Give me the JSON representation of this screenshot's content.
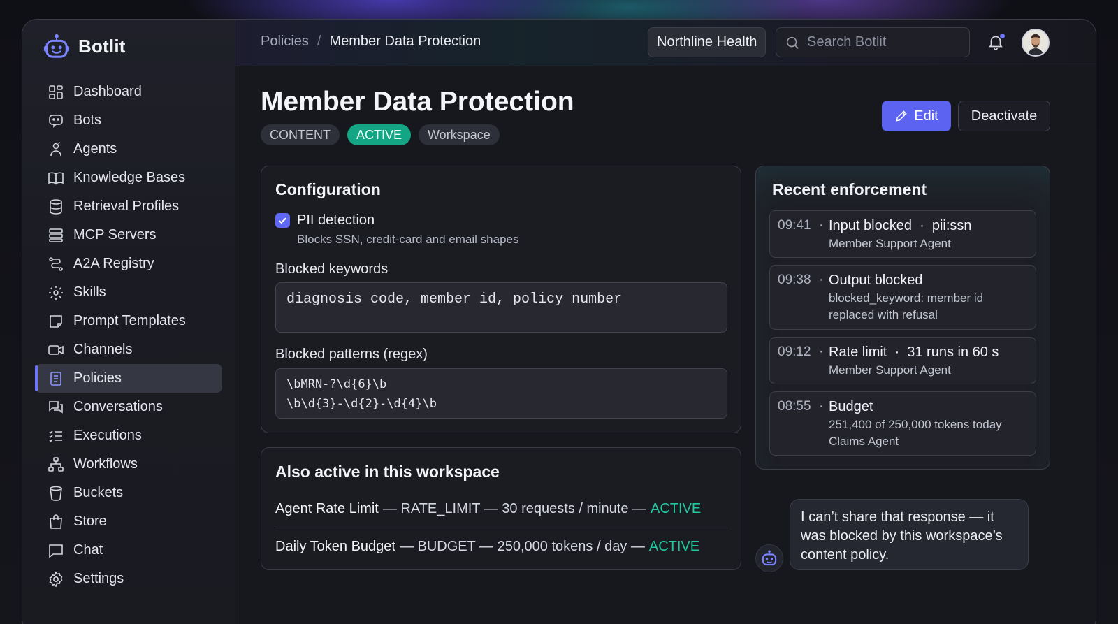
{
  "app": {
    "name": "Botlit"
  },
  "sidebar": {
    "items": [
      {
        "label": "Dashboard",
        "icon": "dashboard-icon"
      },
      {
        "label": "Bots",
        "icon": "bot-icon"
      },
      {
        "label": "Agents",
        "icon": "agent-icon"
      },
      {
        "label": "Knowledge Bases",
        "icon": "book-icon"
      },
      {
        "label": "Retrieval Profiles",
        "icon": "database-icon"
      },
      {
        "label": "MCP Servers",
        "icon": "server-icon"
      },
      {
        "label": "A2A Registry",
        "icon": "route-icon"
      },
      {
        "label": "Skills",
        "icon": "gear-icon"
      },
      {
        "label": "Prompt Templates",
        "icon": "sticky-note-icon"
      },
      {
        "label": "Channels",
        "icon": "video-icon"
      },
      {
        "label": "Policies",
        "icon": "document-icon",
        "active": true
      },
      {
        "label": "Conversations",
        "icon": "chat-bubbles-icon"
      },
      {
        "label": "Executions",
        "icon": "list-icon"
      },
      {
        "label": "Workflows",
        "icon": "workflow-icon"
      },
      {
        "label": "Buckets",
        "icon": "bucket-icon"
      },
      {
        "label": "Store",
        "icon": "shopping-bag-icon"
      },
      {
        "label": "Chat",
        "icon": "chat-icon"
      },
      {
        "label": "Settings",
        "icon": "settings-icon"
      }
    ]
  },
  "topbar": {
    "breadcrumb": {
      "parent": "Policies",
      "separator": "/",
      "current": "Member Data Protection"
    },
    "org": "Northline Health",
    "search_placeholder": "Search Botlit"
  },
  "page": {
    "title": "Member Data Protection",
    "tags": [
      {
        "label": "CONTENT",
        "style": "neutral"
      },
      {
        "label": "ACTIVE",
        "style": "active"
      },
      {
        "label": "Workspace",
        "style": "neutral"
      }
    ],
    "edit_label": "Edit",
    "deactivate_label": "Deactivate"
  },
  "configuration": {
    "title": "Configuration",
    "pii": {
      "label": "PII detection",
      "checked": true,
      "help": "Blocks SSN, credit-card and email shapes"
    },
    "keywords_label": "Blocked keywords",
    "keywords_value": "diagnosis code, member id, policy number",
    "patterns_label": "Blocked patterns (regex)",
    "patterns_value": "\\bMRN-?\\d{6}\\b\n\\b\\d{3}-\\d{2}-\\d{4}\\b"
  },
  "also_active": {
    "title": "Also active in this workspace",
    "rows": [
      {
        "name": "Agent Rate Limit",
        "details": "— RATE_LIMIT — 30 requests / minute —",
        "status": "ACTIVE"
      },
      {
        "name": "Daily Token Budget",
        "details": "— BUDGET — 250,000 tokens / day —",
        "status": "ACTIVE"
      }
    ]
  },
  "enforcement": {
    "title": "Recent enforcement",
    "events": [
      {
        "time": "09:41",
        "dot": "·",
        "title": "Input blocked  ·  pii:ssn",
        "sub": "Member Support Agent"
      },
      {
        "time": "09:38",
        "dot": "·",
        "title": "Output blocked",
        "sub": "blocked_keyword: member id replaced with refusal"
      },
      {
        "time": "09:12",
        "dot": "·",
        "title": "Rate limit  ·  31 runs in 60 s",
        "sub": "Member Support Agent"
      },
      {
        "time": "08:55",
        "dot": "·",
        "title": "Budget",
        "sub": "251,400 of 250,000 tokens today\nClaims Agent"
      }
    ]
  },
  "chat_preview": {
    "message": "I can’t share that response — it was blocked by this workspace’s content policy."
  },
  "colors": {
    "accent": "#5b63f0",
    "active_green": "#14a585",
    "active_text": "#20c9a0"
  }
}
